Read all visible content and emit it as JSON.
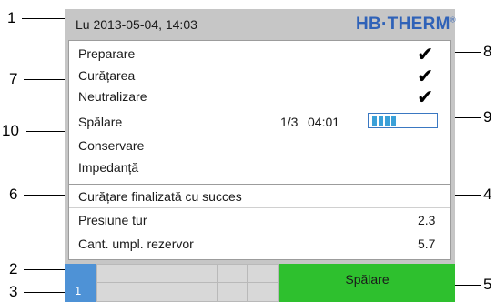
{
  "header": {
    "datetime": "Lu  2013-05-04,  14:03",
    "logo": "HB·THERM",
    "logo_mark": "®"
  },
  "steps": [
    {
      "label": "Preparare",
      "status": "done"
    },
    {
      "label": "Curățarea",
      "status": "done"
    },
    {
      "label": "Neutralizare",
      "status": "done"
    },
    {
      "label": "Spălare",
      "status": "active"
    },
    {
      "label": "Conservare",
      "status": "pending"
    },
    {
      "label": "Impedanță",
      "status": "pending"
    }
  ],
  "progress": {
    "step": "1/3",
    "time": "04:01",
    "fill_fraction": 0.35
  },
  "message": "Curățare finalizată cu succes",
  "measurements": [
    {
      "label": "Presiune tur",
      "value": "2.3"
    },
    {
      "label": "Cant. umpl. rezervor",
      "value": "5.7"
    }
  ],
  "footer": {
    "unit_number": "1",
    "status_label": "Spălare"
  },
  "callouts": [
    "1",
    "7",
    "10",
    "6",
    "2",
    "3",
    "8",
    "9",
    "4",
    "5"
  ],
  "colors": {
    "logo": "#2f62b8",
    "progress_fill": "#3aa0d8",
    "unit_box": "#4e92d6",
    "status_box": "#2ec02e",
    "screen_bg": "#c6c6c6"
  }
}
